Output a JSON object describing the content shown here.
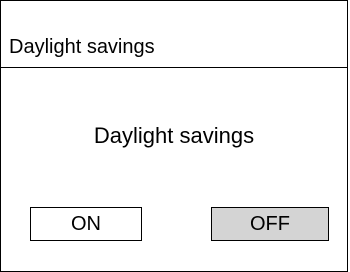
{
  "window": {
    "title": "Daylight savings"
  },
  "content": {
    "heading": "Daylight savings"
  },
  "toggle": {
    "on_label": "ON",
    "off_label": "OFF",
    "selected": "OFF",
    "selected_color": "#d4d4d4",
    "unselected_color": "#ffffff"
  }
}
